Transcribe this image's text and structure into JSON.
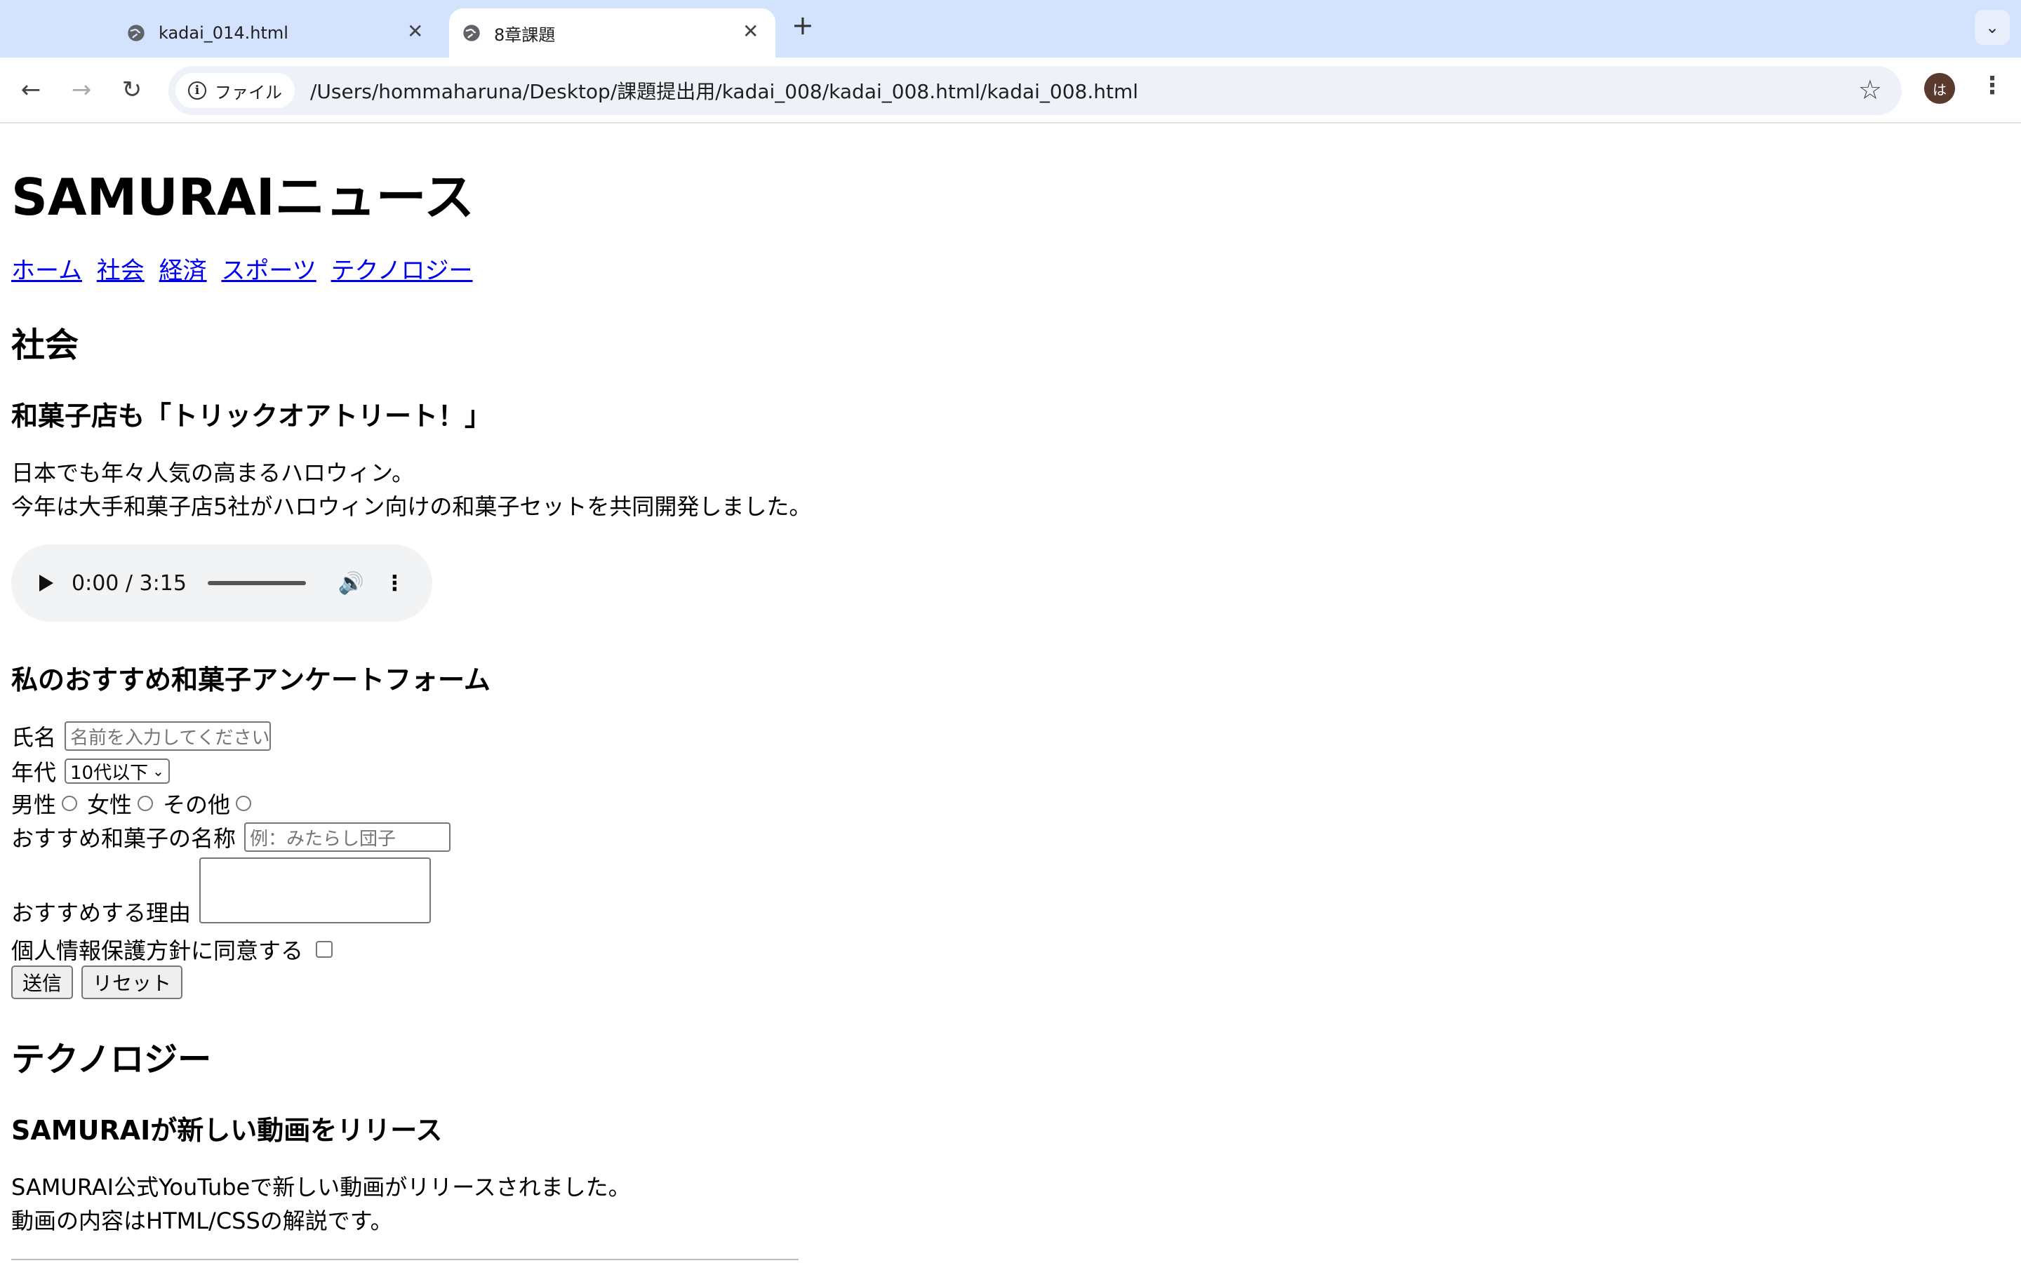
{
  "browser": {
    "tabs": [
      {
        "title": "kadai_014.html",
        "active": false
      },
      {
        "title": "8章課題",
        "active": true
      }
    ],
    "address_chip": "ファイル",
    "url": "/Users/hommaharuna/Desktop/課題提出用/kadai_008/kadai_008.html/kadai_008.html",
    "avatar_letter": "は"
  },
  "site": {
    "title": "SAMURAIニュース",
    "nav": [
      "ホーム",
      "社会",
      "経済",
      "スポーツ",
      "テクノロジー"
    ]
  },
  "society": {
    "heading": "社会",
    "article_title": "和菓子店も「トリックオアトリート！」",
    "lines": [
      "日本でも年々人気の高まるハロウィン。",
      "今年は大手和菓子店5社がハロウィン向けの和菓子セットを共同開発しました。"
    ],
    "audio_time": "0:00 / 3:15"
  },
  "survey": {
    "title": "私のおすすめ和菓子アンケートフォーム",
    "name_label": "氏名",
    "name_placeholder": "名前を入力してください",
    "age_label": "年代",
    "age_selected": "10代以下",
    "gender_options": [
      "男性",
      "女性",
      "その他"
    ],
    "sweet_label": "おすすめ和菓子の名称",
    "sweet_placeholder": "例：みたらし団子",
    "reason_label": "おすすめする理由",
    "privacy_label": "個人情報保護方針に同意する",
    "submit_label": "送信",
    "reset_label": "リセット"
  },
  "technology": {
    "heading": "テクノロジー",
    "article_title": "SAMURAIが新しい動画をリリース",
    "lines": [
      "SAMURAI公式YouTubeで新しい動画がリリースされました。",
      "動画の内容はHTML/CSSの解説です。"
    ]
  }
}
